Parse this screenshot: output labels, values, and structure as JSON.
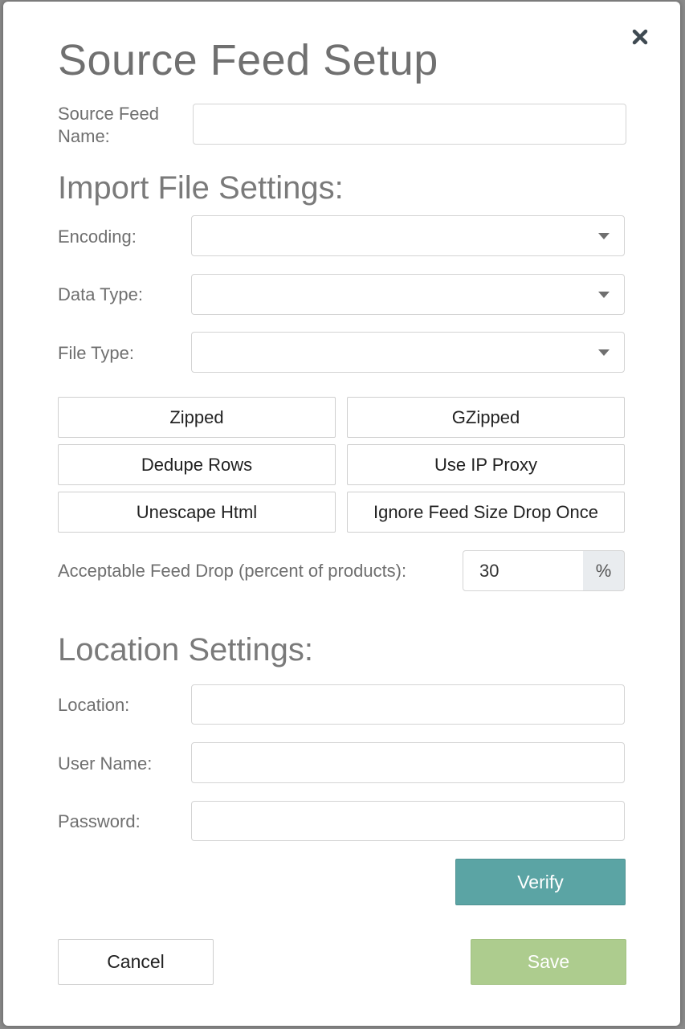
{
  "modal": {
    "title": "Source Feed Setup",
    "close_icon": "close-icon"
  },
  "source_feed": {
    "name_label": "Source Feed Name:",
    "name_value": ""
  },
  "import_settings": {
    "heading": "Import File Settings:",
    "encoding_label": "Encoding:",
    "encoding_value": "",
    "data_type_label": "Data Type:",
    "data_type_value": "",
    "file_type_label": "File Type:",
    "file_type_value": "",
    "toggles": [
      "Zipped",
      "GZipped",
      "Dedupe Rows",
      "Use IP Proxy",
      "Unescape Html",
      "Ignore Feed Size Drop Once"
    ],
    "feed_drop_label": "Acceptable Feed Drop (percent of products):",
    "feed_drop_value": "30",
    "feed_drop_unit": "%"
  },
  "location_settings": {
    "heading": "Location Settings:",
    "location_label": "Location:",
    "location_value": "",
    "username_label": "User Name:",
    "username_value": "",
    "password_label": "Password:",
    "password_value": "",
    "verify_label": "Verify"
  },
  "footer": {
    "cancel_label": "Cancel",
    "save_label": "Save"
  },
  "colors": {
    "verify": "#5ba4a4",
    "save": "#adcc8e",
    "title": "#707070"
  }
}
